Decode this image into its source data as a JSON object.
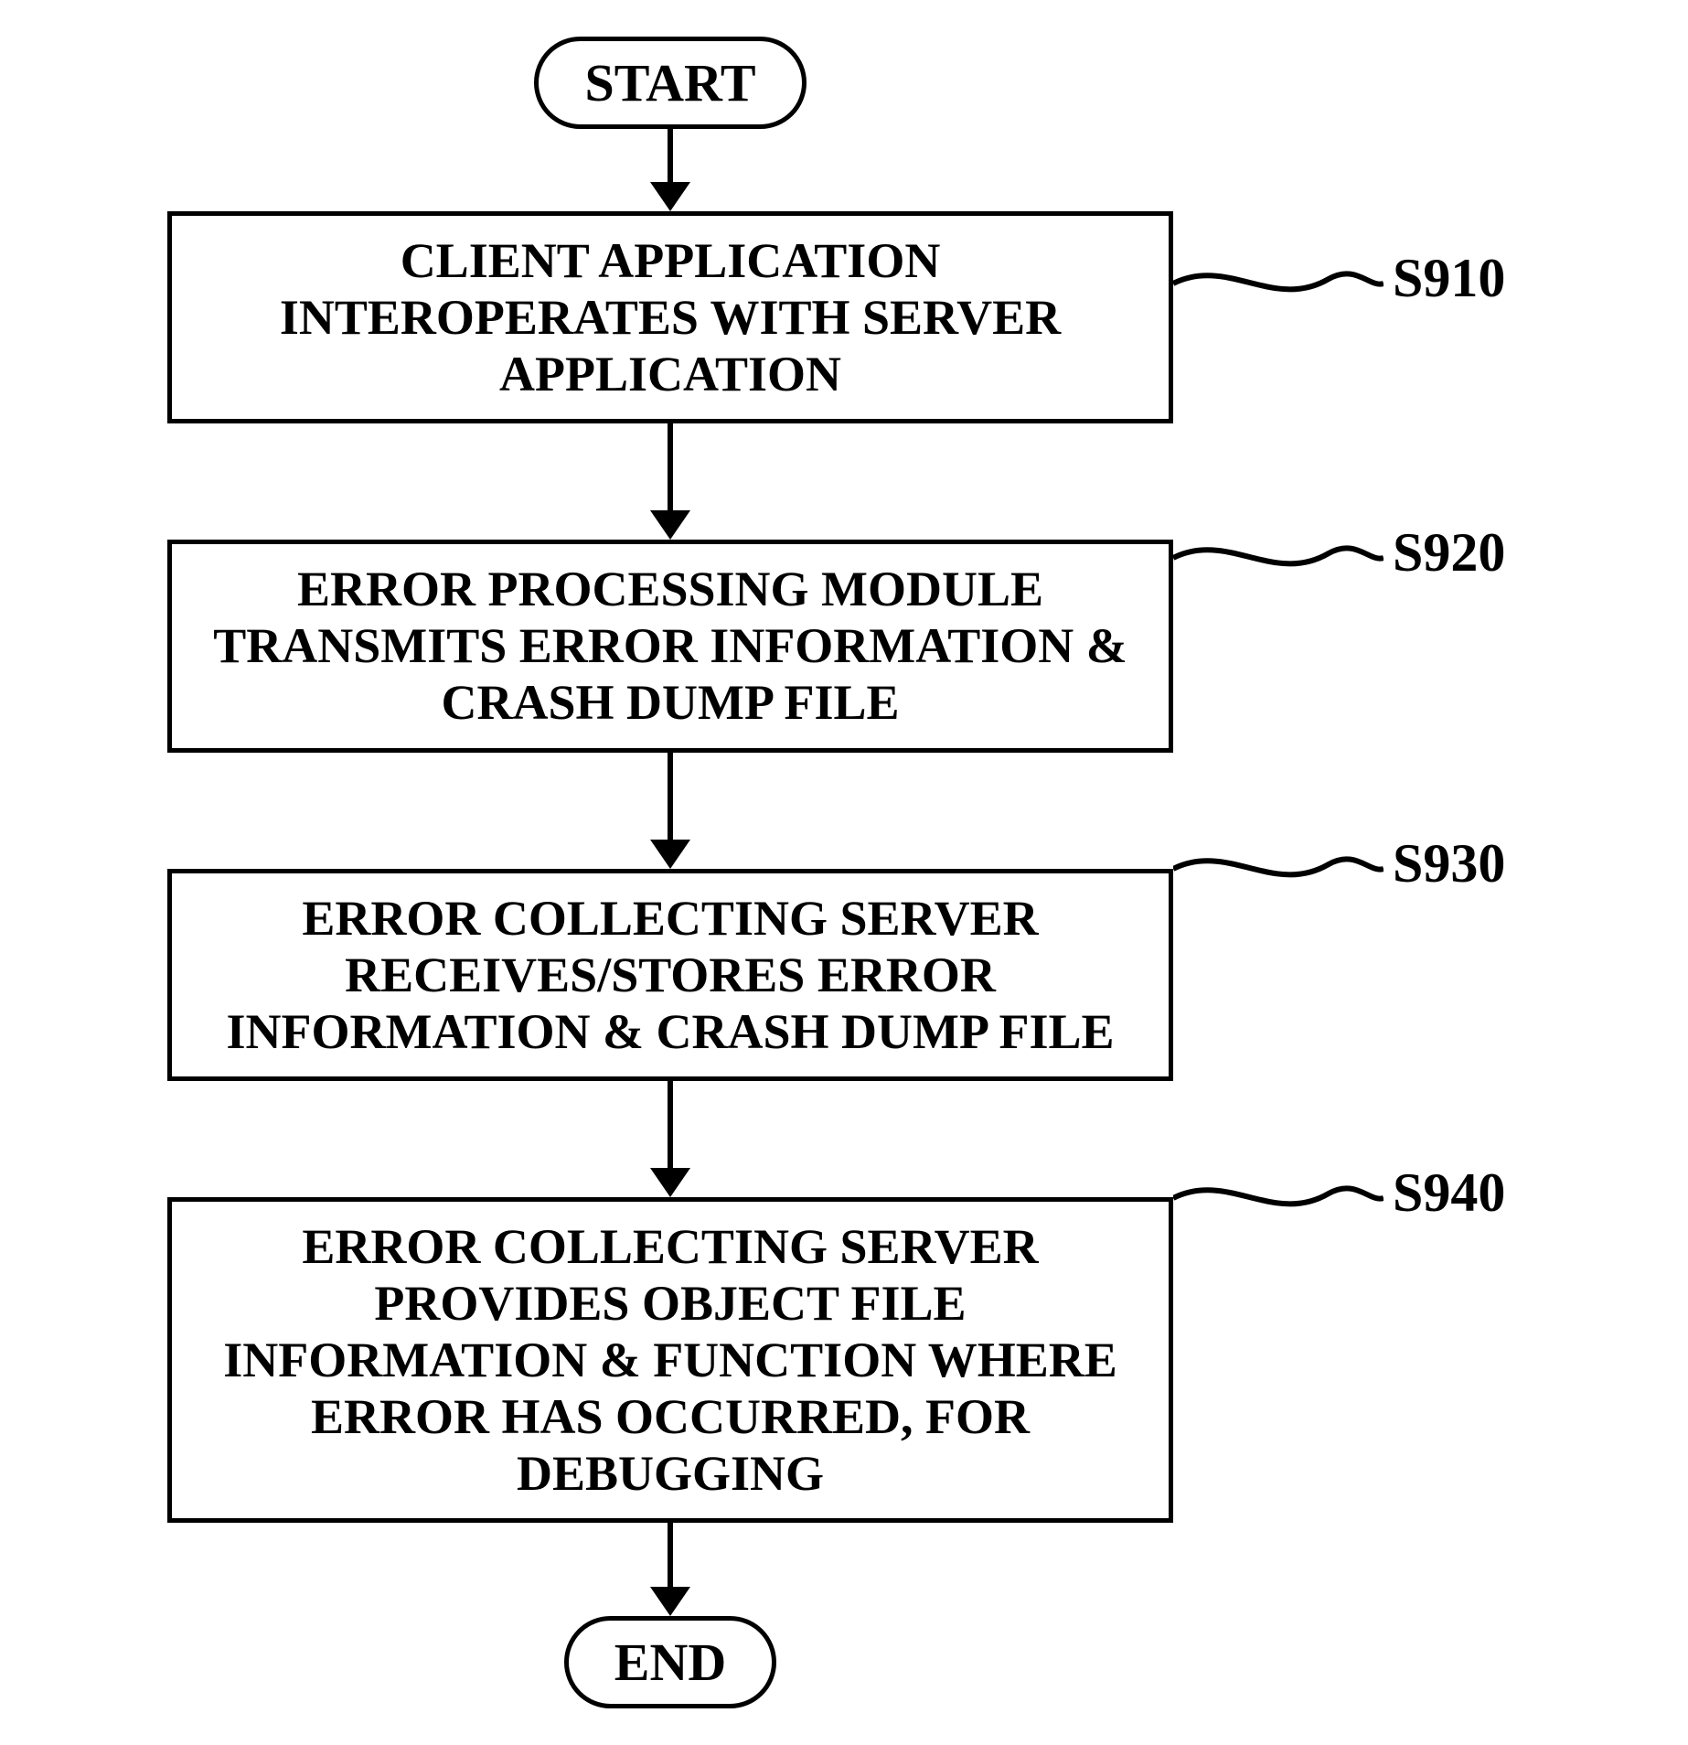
{
  "flowchart": {
    "start": "START",
    "end": "END",
    "steps": [
      {
        "text": "CLIENT APPLICATION INTEROPERATES WITH SERVER APPLICATION",
        "ref": "S910"
      },
      {
        "text": "ERROR PROCESSING MODULE TRANSMITS ERROR INFORMATION & CRASH DUMP FILE",
        "ref": "S920"
      },
      {
        "text": "ERROR COLLECTING SERVER RECEIVES/STORES ERROR INFORMATION & CRASH DUMP FILE",
        "ref": "S930"
      },
      {
        "text": "ERROR COLLECTING SERVER PROVIDES OBJECT FILE INFORMATION & FUNCTION WHERE ERROR HAS OCCURRED, FOR DEBUGGING",
        "ref": "S940"
      }
    ]
  }
}
